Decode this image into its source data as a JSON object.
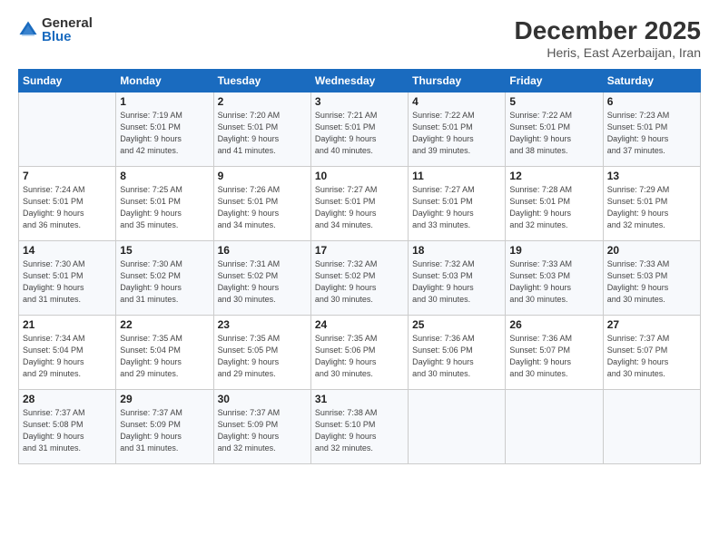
{
  "logo": {
    "general": "General",
    "blue": "Blue"
  },
  "header": {
    "month": "December 2025",
    "location": "Heris, East Azerbaijan, Iran"
  },
  "days_of_week": [
    "Sunday",
    "Monday",
    "Tuesday",
    "Wednesday",
    "Thursday",
    "Friday",
    "Saturday"
  ],
  "weeks": [
    [
      {
        "day": "",
        "info": ""
      },
      {
        "day": "1",
        "info": "Sunrise: 7:19 AM\nSunset: 5:01 PM\nDaylight: 9 hours\nand 42 minutes."
      },
      {
        "day": "2",
        "info": "Sunrise: 7:20 AM\nSunset: 5:01 PM\nDaylight: 9 hours\nand 41 minutes."
      },
      {
        "day": "3",
        "info": "Sunrise: 7:21 AM\nSunset: 5:01 PM\nDaylight: 9 hours\nand 40 minutes."
      },
      {
        "day": "4",
        "info": "Sunrise: 7:22 AM\nSunset: 5:01 PM\nDaylight: 9 hours\nand 39 minutes."
      },
      {
        "day": "5",
        "info": "Sunrise: 7:22 AM\nSunset: 5:01 PM\nDaylight: 9 hours\nand 38 minutes."
      },
      {
        "day": "6",
        "info": "Sunrise: 7:23 AM\nSunset: 5:01 PM\nDaylight: 9 hours\nand 37 minutes."
      }
    ],
    [
      {
        "day": "7",
        "info": "Sunrise: 7:24 AM\nSunset: 5:01 PM\nDaylight: 9 hours\nand 36 minutes."
      },
      {
        "day": "8",
        "info": "Sunrise: 7:25 AM\nSunset: 5:01 PM\nDaylight: 9 hours\nand 35 minutes."
      },
      {
        "day": "9",
        "info": "Sunrise: 7:26 AM\nSunset: 5:01 PM\nDaylight: 9 hours\nand 34 minutes."
      },
      {
        "day": "10",
        "info": "Sunrise: 7:27 AM\nSunset: 5:01 PM\nDaylight: 9 hours\nand 34 minutes."
      },
      {
        "day": "11",
        "info": "Sunrise: 7:27 AM\nSunset: 5:01 PM\nDaylight: 9 hours\nand 33 minutes."
      },
      {
        "day": "12",
        "info": "Sunrise: 7:28 AM\nSunset: 5:01 PM\nDaylight: 9 hours\nand 32 minutes."
      },
      {
        "day": "13",
        "info": "Sunrise: 7:29 AM\nSunset: 5:01 PM\nDaylight: 9 hours\nand 32 minutes."
      }
    ],
    [
      {
        "day": "14",
        "info": "Sunrise: 7:30 AM\nSunset: 5:01 PM\nDaylight: 9 hours\nand 31 minutes."
      },
      {
        "day": "15",
        "info": "Sunrise: 7:30 AM\nSunset: 5:02 PM\nDaylight: 9 hours\nand 31 minutes."
      },
      {
        "day": "16",
        "info": "Sunrise: 7:31 AM\nSunset: 5:02 PM\nDaylight: 9 hours\nand 30 minutes."
      },
      {
        "day": "17",
        "info": "Sunrise: 7:32 AM\nSunset: 5:02 PM\nDaylight: 9 hours\nand 30 minutes."
      },
      {
        "day": "18",
        "info": "Sunrise: 7:32 AM\nSunset: 5:03 PM\nDaylight: 9 hours\nand 30 minutes."
      },
      {
        "day": "19",
        "info": "Sunrise: 7:33 AM\nSunset: 5:03 PM\nDaylight: 9 hours\nand 30 minutes."
      },
      {
        "day": "20",
        "info": "Sunrise: 7:33 AM\nSunset: 5:03 PM\nDaylight: 9 hours\nand 30 minutes."
      }
    ],
    [
      {
        "day": "21",
        "info": "Sunrise: 7:34 AM\nSunset: 5:04 PM\nDaylight: 9 hours\nand 29 minutes."
      },
      {
        "day": "22",
        "info": "Sunrise: 7:35 AM\nSunset: 5:04 PM\nDaylight: 9 hours\nand 29 minutes."
      },
      {
        "day": "23",
        "info": "Sunrise: 7:35 AM\nSunset: 5:05 PM\nDaylight: 9 hours\nand 29 minutes."
      },
      {
        "day": "24",
        "info": "Sunrise: 7:35 AM\nSunset: 5:06 PM\nDaylight: 9 hours\nand 30 minutes."
      },
      {
        "day": "25",
        "info": "Sunrise: 7:36 AM\nSunset: 5:06 PM\nDaylight: 9 hours\nand 30 minutes."
      },
      {
        "day": "26",
        "info": "Sunrise: 7:36 AM\nSunset: 5:07 PM\nDaylight: 9 hours\nand 30 minutes."
      },
      {
        "day": "27",
        "info": "Sunrise: 7:37 AM\nSunset: 5:07 PM\nDaylight: 9 hours\nand 30 minutes."
      }
    ],
    [
      {
        "day": "28",
        "info": "Sunrise: 7:37 AM\nSunset: 5:08 PM\nDaylight: 9 hours\nand 31 minutes."
      },
      {
        "day": "29",
        "info": "Sunrise: 7:37 AM\nSunset: 5:09 PM\nDaylight: 9 hours\nand 31 minutes."
      },
      {
        "day": "30",
        "info": "Sunrise: 7:37 AM\nSunset: 5:09 PM\nDaylight: 9 hours\nand 32 minutes."
      },
      {
        "day": "31",
        "info": "Sunrise: 7:38 AM\nSunset: 5:10 PM\nDaylight: 9 hours\nand 32 minutes."
      },
      {
        "day": "",
        "info": ""
      },
      {
        "day": "",
        "info": ""
      },
      {
        "day": "",
        "info": ""
      }
    ]
  ]
}
